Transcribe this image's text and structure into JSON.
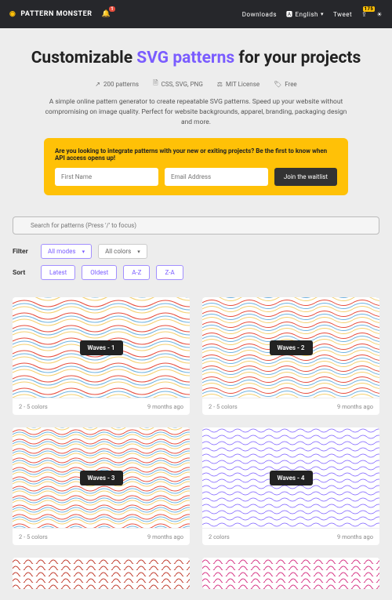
{
  "nav": {
    "brand": "PATTERN MONSTER",
    "bell_badge": "1",
    "downloads": "Downloads",
    "language": "English",
    "tweet": "Tweet",
    "tweet_badge": "175"
  },
  "hero": {
    "title_pre": "Customizable ",
    "title_accent": "SVG patterns",
    "title_post": " for your projects",
    "meta": {
      "patterns": "200 patterns",
      "formats": "CSS, SVG, PNG",
      "license": "MIT License",
      "price": "Free"
    },
    "desc": "A simple online pattern generator to create repeatable SVG patterns. Speed up your website without compromising on image quality. Perfect for website backgrounds, apparel, branding, packaging design and more."
  },
  "waitlist": {
    "q": "Are you looking to integrate patterns with your new or exiting projects? Be the first to know when API access opens up!",
    "first_ph": "First Name",
    "email_ph": "Email Address",
    "btn": "Join the waitlist"
  },
  "search": {
    "placeholder": "Search for patterns (Press '/' to focus)"
  },
  "filter": {
    "label": "Filter",
    "modes": "All modes",
    "colors": "All colors"
  },
  "sort": {
    "label": "Sort",
    "latest": "Latest",
    "oldest": "Oldest",
    "az": "A-Z",
    "za": "Z-A"
  },
  "cards": [
    {
      "title": "Waves - 1",
      "colors": "2 - 5 colors",
      "age": "9 months ago"
    },
    {
      "title": "Waves - 2",
      "colors": "2 - 5 colors",
      "age": "9 months ago"
    },
    {
      "title": "Waves - 3",
      "colors": "2 - 5 colors",
      "age": "9 months ago"
    },
    {
      "title": "Waves - 4",
      "colors": "2 colors",
      "age": "9 months ago"
    }
  ]
}
